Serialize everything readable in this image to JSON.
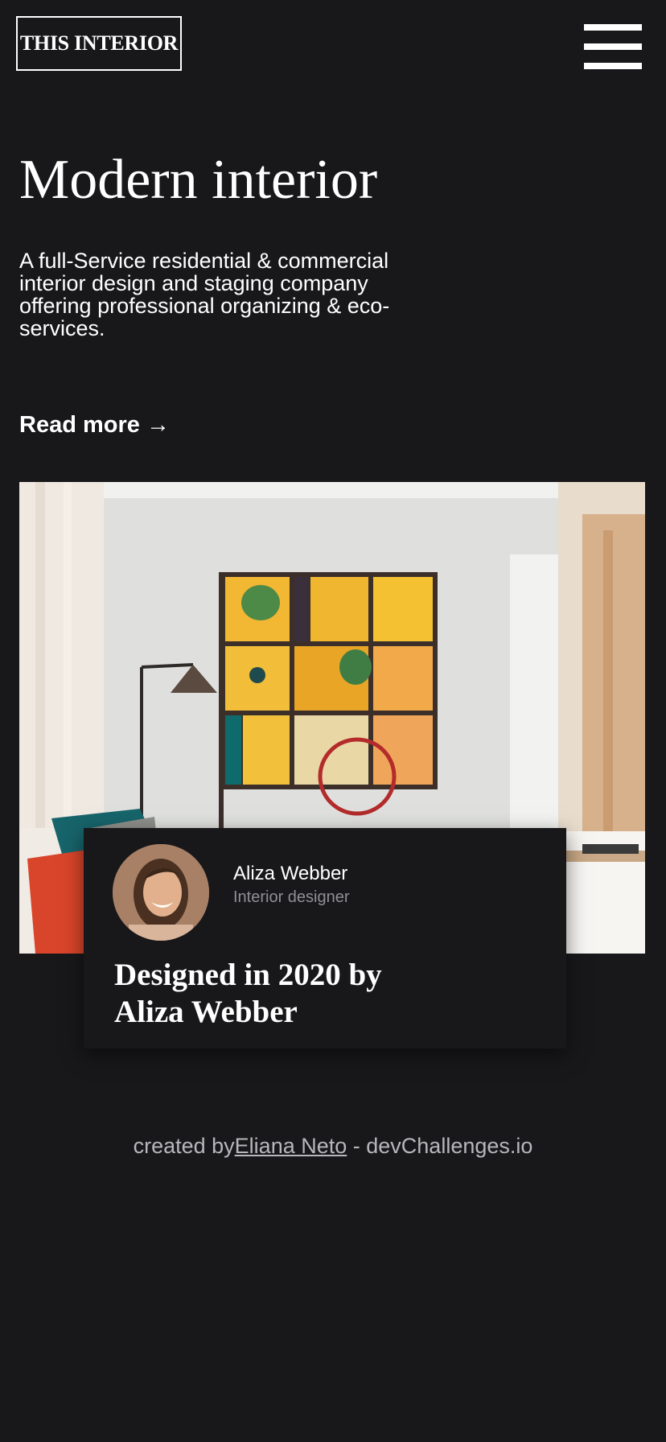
{
  "header": {
    "logo": "THIS INTERIOR",
    "menu_icon": "hamburger-menu-icon"
  },
  "hero": {
    "title": "Modern interior",
    "description": "A full-Service residential & commercial interior design and staging company offering professional organizing & eco-services.",
    "read_more": "Read more →"
  },
  "card": {
    "author_name": "Aliza Webber",
    "author_role": "Interior designer",
    "title": "Designed in 2020 by Aliza Webber"
  },
  "footer": {
    "prefix": "created by",
    "link": "Eliana Neto",
    "suffix": " - devChallenges.io"
  },
  "colors": {
    "background": "#18171a",
    "text": "#ffffff",
    "muted": "#8f8f94"
  }
}
